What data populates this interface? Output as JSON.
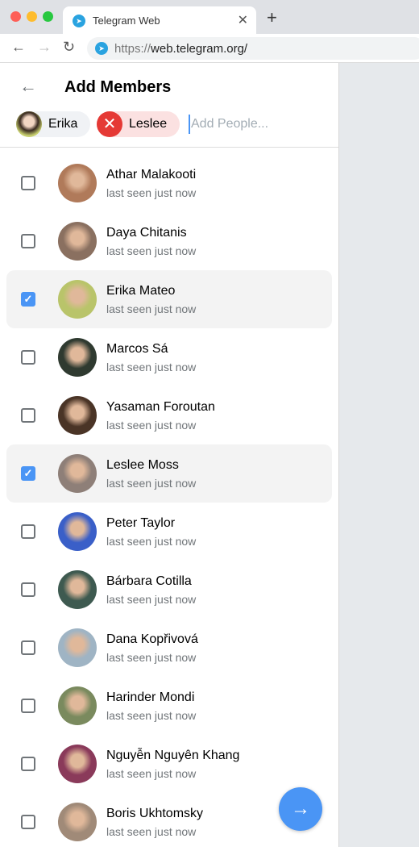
{
  "browser": {
    "tab_title": "Telegram Web",
    "url_scheme": "https://",
    "url_host": "web.telegram.org/"
  },
  "header": {
    "title": "Add Members"
  },
  "chips": [
    {
      "label": "Erika"
    },
    {
      "label": "Leslee"
    }
  ],
  "search": {
    "placeholder": "Add People..."
  },
  "contacts": [
    {
      "name": "Athar Malakooti",
      "status": "last seen just now",
      "checked": false,
      "color": "#b07a5a"
    },
    {
      "name": "Daya Chitanis",
      "status": "last seen just now",
      "checked": false,
      "color": "#8a7060"
    },
    {
      "name": "Erika Mateo",
      "status": "last seen just now",
      "checked": true,
      "color": "#b9c46a"
    },
    {
      "name": "Marcos Sá",
      "status": "last seen just now",
      "checked": false,
      "color": "#2f3a30"
    },
    {
      "name": "Yasaman Foroutan",
      "status": "last seen just now",
      "checked": false,
      "color": "#4a3426"
    },
    {
      "name": "Leslee Moss",
      "status": "last seen just now",
      "checked": true,
      "color": "#8e7f78"
    },
    {
      "name": "Peter Taylor",
      "status": "last seen just now",
      "checked": false,
      "color": "#3a5fc8"
    },
    {
      "name": "Bárbara Cotilla",
      "status": "last seen just now",
      "checked": false,
      "color": "#3e5a50"
    },
    {
      "name": "Dana Kopřivová",
      "status": "last seen just now",
      "checked": false,
      "color": "#9fb4c4"
    },
    {
      "name": "Harinder Mondi",
      "status": "last seen just now",
      "checked": false,
      "color": "#7a8a5e"
    },
    {
      "name": "Nguyễn Nguyên Khang",
      "status": "last seen just now",
      "checked": false,
      "color": "#8a3a5a"
    },
    {
      "name": "Boris Ukhtomsky",
      "status": "last seen just now",
      "checked": false,
      "color": "#a08a78"
    }
  ]
}
